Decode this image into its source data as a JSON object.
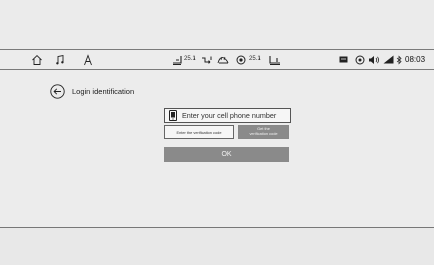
{
  "status_bar": {
    "icons_left": [
      "home-icon",
      "music-icon",
      "navigation-icon"
    ],
    "climate_left_temp": "25.1",
    "climate_right_temp": "25.1",
    "climate_icons": [
      "seat-heat-left-icon",
      "airflow-icon",
      "fan-icon",
      "ac-icon",
      "seat-heat-right-icon"
    ],
    "icons_right": [
      "message-icon",
      "location-icon",
      "volume-icon",
      "signal-icon",
      "bluetooth-icon"
    ],
    "time": "08:03"
  },
  "login": {
    "title": "Login identification",
    "phone_placeholder": "Enter your cell phone number",
    "code_placeholder": "Enter the verification code",
    "get_code_label": "Get the\nverification code",
    "ok_label": "OK"
  },
  "colors": {
    "background": "#ececec",
    "button_gray": "#8a8a8a",
    "border": "#777777",
    "text": "#222222"
  }
}
